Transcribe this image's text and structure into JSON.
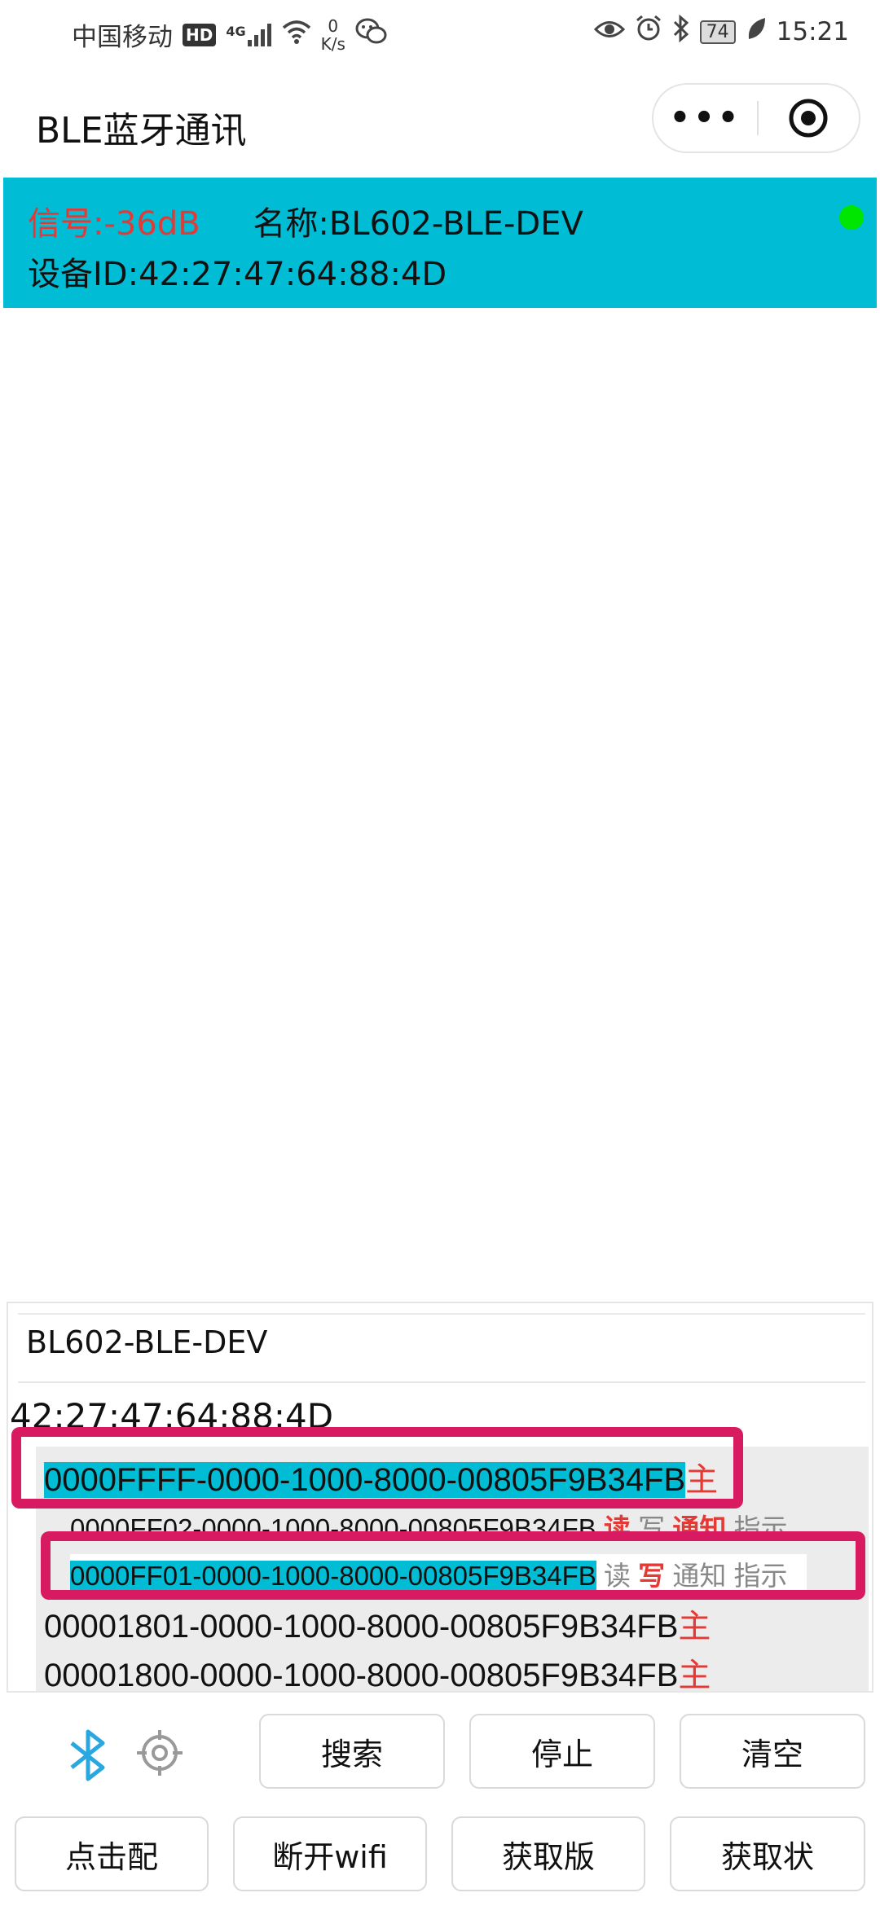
{
  "status_bar": {
    "carrier": "中国移动",
    "hd": "HD",
    "signal_label": "4G",
    "net_speed_value": "0",
    "net_speed_unit": "K/s",
    "battery": "74",
    "time": "15:21"
  },
  "title_bar": {
    "title": "BLE蓝牙通讯",
    "more_label": "•••"
  },
  "device_card": {
    "signal_label": "信号:",
    "signal_value": "-36dB",
    "name_label": "名称:",
    "name_value": "BL602-BLE-DEV",
    "id_label": "设备ID:",
    "id_value": "42:27:47:64:88:4D",
    "status_color": "#00e600"
  },
  "detail_panel": {
    "device_name": "BL602-BLE-DEV",
    "device_id": "42:27:47:64:88:4D",
    "services": [
      {
        "uuid": "0000FFFF-0000-1000-8000-00805F9B34FB",
        "tag": "主"
      },
      {
        "uuid": "00001801-0000-1000-8000-00805F9B34FB",
        "tag": "主"
      },
      {
        "uuid": "00001800-0000-1000-8000-00805F9B34FB",
        "tag": "主"
      }
    ],
    "characteristics": [
      {
        "uuid": "0000FF02-0000-1000-8000-00805F9B34FB",
        "read": "读",
        "write": "写",
        "notify": "通知",
        "indicate": "指示"
      },
      {
        "uuid": "0000FF01-0000-1000-8000-00805F9B34FB",
        "read": "读",
        "write": "写",
        "notify": "通知",
        "indicate": "指示"
      }
    ]
  },
  "buttons": {
    "search": "搜索",
    "stop": "停止",
    "clear": "清空",
    "pair": "点击配",
    "disconnect_wifi": "断开wifi",
    "get_version": "获取版",
    "get_status": "获取状"
  },
  "colors": {
    "accent": "#00bcd4",
    "highlight_frame": "#d81b60",
    "active_text": "#e53935",
    "bluetooth_icon": "#29a8e0"
  }
}
